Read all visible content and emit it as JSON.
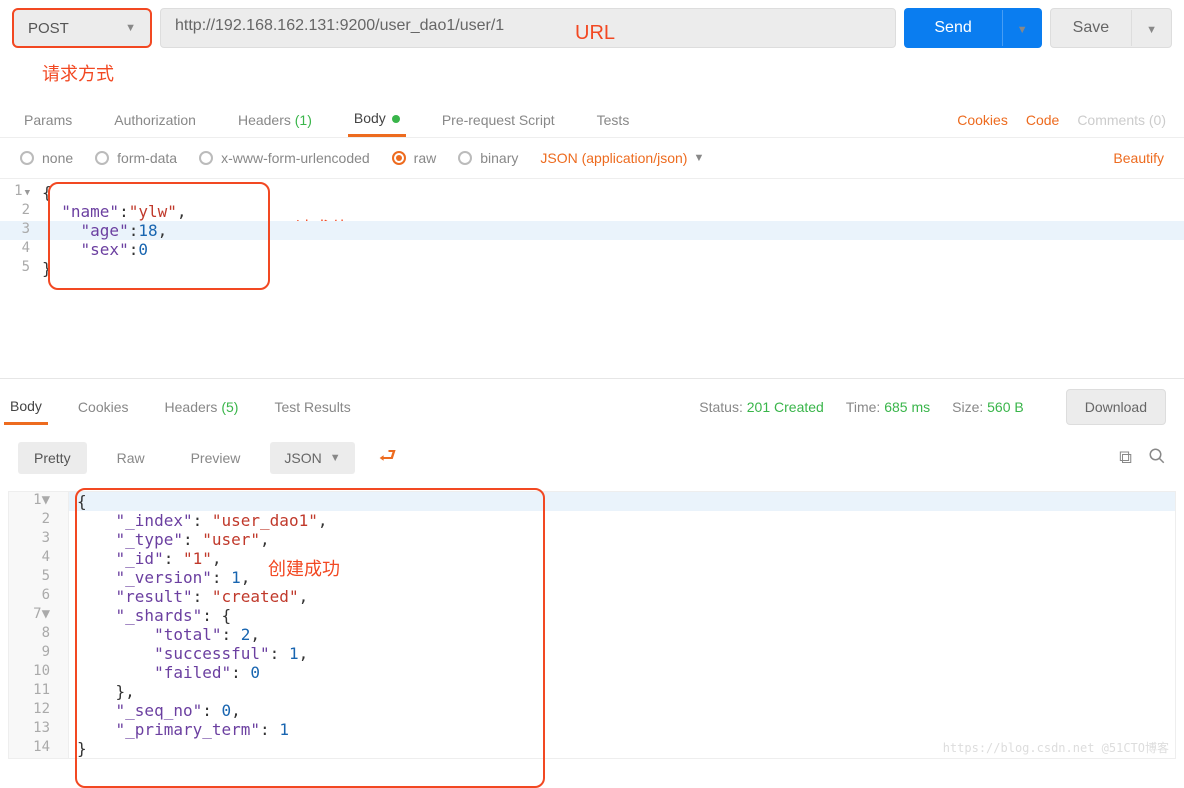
{
  "toolbar": {
    "method": "POST",
    "url": "http://192.168.162.131:9200/user_dao1/user/1",
    "send": "Send",
    "save": "Save"
  },
  "annotations": {
    "method": "请求方式",
    "url": "URL",
    "body": "请求体",
    "success": "创建成功"
  },
  "request_tabs": {
    "params": "Params",
    "authorization": "Authorization",
    "headers": "Headers",
    "headers_count": "(1)",
    "body": "Body",
    "prerequest": "Pre-request Script",
    "tests": "Tests",
    "cookies": "Cookies",
    "code": "Code",
    "comments": "Comments (0)"
  },
  "body_options": {
    "none": "none",
    "formdata": "form-data",
    "xform": "x-www-form-urlencoded",
    "raw": "raw",
    "binary": "binary",
    "content_type": "JSON (application/json)",
    "beautify": "Beautify"
  },
  "request_body_lines": [
    {
      "n": "1",
      "t": "{",
      "fold": true
    },
    {
      "n": "2",
      "t": "  \"name\":\"ylw\","
    },
    {
      "n": "3",
      "t": "    \"age\":18,",
      "hl": true
    },
    {
      "n": "4",
      "t": "    \"sex\":0"
    },
    {
      "n": "5",
      "t": "}"
    }
  ],
  "response_tabs": {
    "body": "Body",
    "cookies": "Cookies",
    "headers": "Headers",
    "headers_count": "(5)",
    "test_results": "Test Results"
  },
  "response_status": {
    "status_label": "Status:",
    "status_value": "201 Created",
    "time_label": "Time:",
    "time_value": "685 ms",
    "size_label": "Size:",
    "size_value": "560 B",
    "download": "Download"
  },
  "view_modes": {
    "pretty": "Pretty",
    "raw": "Raw",
    "preview": "Preview",
    "format": "JSON"
  },
  "response_body_lines": [
    {
      "n": "1",
      "t": "{",
      "hl": true,
      "fold": true
    },
    {
      "n": "2",
      "t": "    \"_index\": \"user_dao1\","
    },
    {
      "n": "3",
      "t": "    \"_type\": \"user\","
    },
    {
      "n": "4",
      "t": "    \"_id\": \"1\","
    },
    {
      "n": "5",
      "t": "    \"_version\": 1,"
    },
    {
      "n": "6",
      "t": "    \"result\": \"created\","
    },
    {
      "n": "7",
      "t": "    \"_shards\": {",
      "fold": true
    },
    {
      "n": "8",
      "t": "        \"total\": 2,"
    },
    {
      "n": "9",
      "t": "        \"successful\": 1,"
    },
    {
      "n": "10",
      "t": "        \"failed\": 0"
    },
    {
      "n": "11",
      "t": "    },"
    },
    {
      "n": "12",
      "t": "    \"_seq_no\": 0,"
    },
    {
      "n": "13",
      "t": "    \"_primary_term\": 1"
    },
    {
      "n": "14",
      "t": "}"
    }
  ],
  "watermark": "https://blog.csdn.net @51CTO博客"
}
